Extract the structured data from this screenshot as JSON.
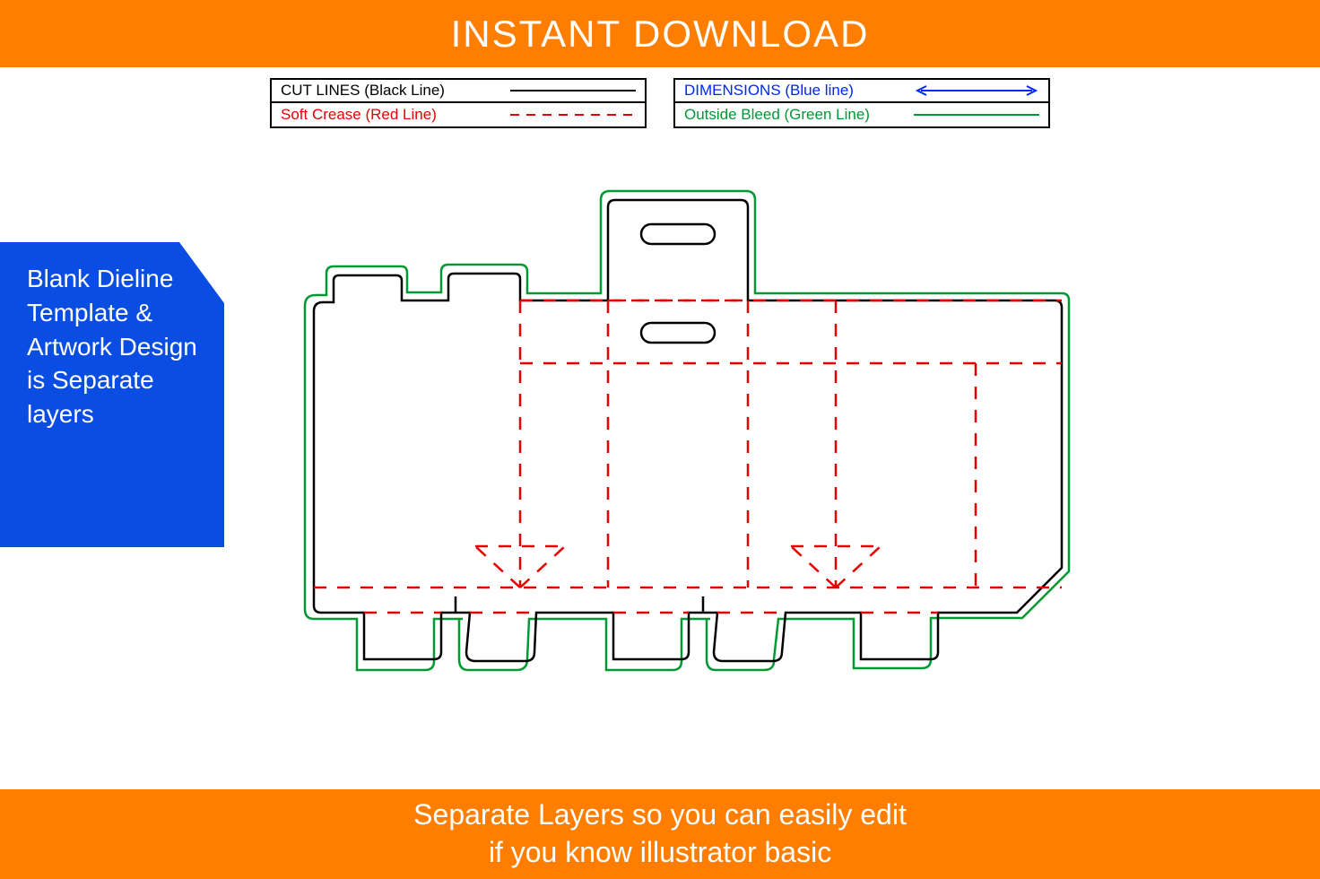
{
  "banner": {
    "top": "INSTANT DOWNLOAD",
    "bottom_line1": "Separate Layers so you can easily edit",
    "bottom_line2": "if you know illustrator basic"
  },
  "legend": {
    "left": [
      {
        "label": "CUT LINES (Black Line)",
        "style": "solid-black"
      },
      {
        "label": "Soft Crease (Red Line)",
        "style": "dashed-red"
      }
    ],
    "right": [
      {
        "label": "DIMENSIONS (Blue line)",
        "style": "arrow-blue"
      },
      {
        "label": "Outside Bleed (Green Line)",
        "style": "solid-green"
      }
    ]
  },
  "callout": {
    "text": "Blank Dieline Template & Artwork Design is Separate layers"
  },
  "colors": {
    "orange": "#ff7e00",
    "blue": "#0a4de3",
    "cut": "#000000",
    "crease": "#e60000",
    "bleed": "#009933",
    "dimension": "#0026ff"
  },
  "diagram": {
    "type": "box-dieline",
    "description": "Carrier box with handle dieline template",
    "layers": [
      "cut-lines",
      "soft-crease",
      "outside-bleed"
    ]
  }
}
